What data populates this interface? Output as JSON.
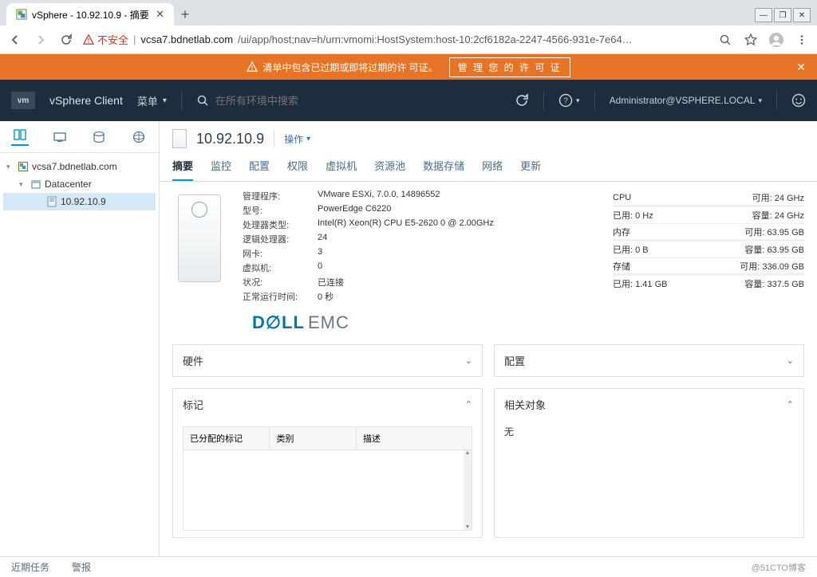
{
  "browser": {
    "tab_title": "vSphere - 10.92.10.9 - 摘要",
    "not_secure": "不安全",
    "url_host": "vcsa7.bdnetlab.com",
    "url_path": "/ui/app/host;nav=h/urn:vmomi:HostSystem:host-10:2cf6182a-2247-4566-931e-7e64…"
  },
  "banner": {
    "text": "清单中包含已过期或即将过期的许 可证。",
    "button": "管 理 您 的 许  可 证"
  },
  "header": {
    "product": "vSphere Client",
    "menu": "菜单",
    "search_placeholder": "在所有环境中搜索",
    "user": "Administrator@VSPHERE.LOCAL"
  },
  "tree": {
    "root": "vcsa7.bdnetlab.com",
    "dc": "Datacenter",
    "host": "10.92.10.9"
  },
  "main": {
    "title": "10.92.10.9",
    "action": "操作",
    "tabs": [
      "摘要",
      "监控",
      "配置",
      "权限",
      "虚拟机",
      "资源池",
      "数据存储",
      "网络",
      "更新"
    ]
  },
  "kv": {
    "hypervisor_k": "管理程序:",
    "hypervisor_v": "VMware ESXi, 7.0.0, 14896552",
    "model_k": "型号:",
    "model_v": "PowerEdge C6220",
    "cpu_k": "处理器类型:",
    "cpu_v": "Intel(R) Xeon(R) CPU E5-2620 0 @ 2.00GHz",
    "lcpu_k": "逻辑处理器:",
    "lcpu_v": "24",
    "nic_k": "网卡:",
    "nic_v": "3",
    "vm_k": "虚拟机:",
    "vm_v": "0",
    "state_k": "状况:",
    "state_v": "已连接",
    "uptime_k": "正常运行时间:",
    "uptime_v": "0 秒"
  },
  "metrics": {
    "cpu_label": "CPU",
    "cpu_free": "可用: 24 GHz",
    "cpu_used": "已用: 0 Hz",
    "cpu_cap": "容量: 24 GHz",
    "mem_label": "内存",
    "mem_free": "可用: 63.95 GB",
    "mem_used": "已用: 0 B",
    "mem_cap": "容量: 63.95 GB",
    "stor_label": "存储",
    "stor_free": "可用: 336.09 GB",
    "stor_used": "已用: 1.41 GB",
    "stor_cap": "容量: 337.5 GB"
  },
  "cards": {
    "hardware": "硬件",
    "config": "配置",
    "tags": "标记",
    "related": "相关对象",
    "related_empty": "无",
    "tag_cols": {
      "assigned": "已分配的标记",
      "category": "类别",
      "desc": "描述"
    }
  },
  "bottom": {
    "tasks": "近期任务",
    "alarms": "警报",
    "blog": "@51CTO博客"
  }
}
